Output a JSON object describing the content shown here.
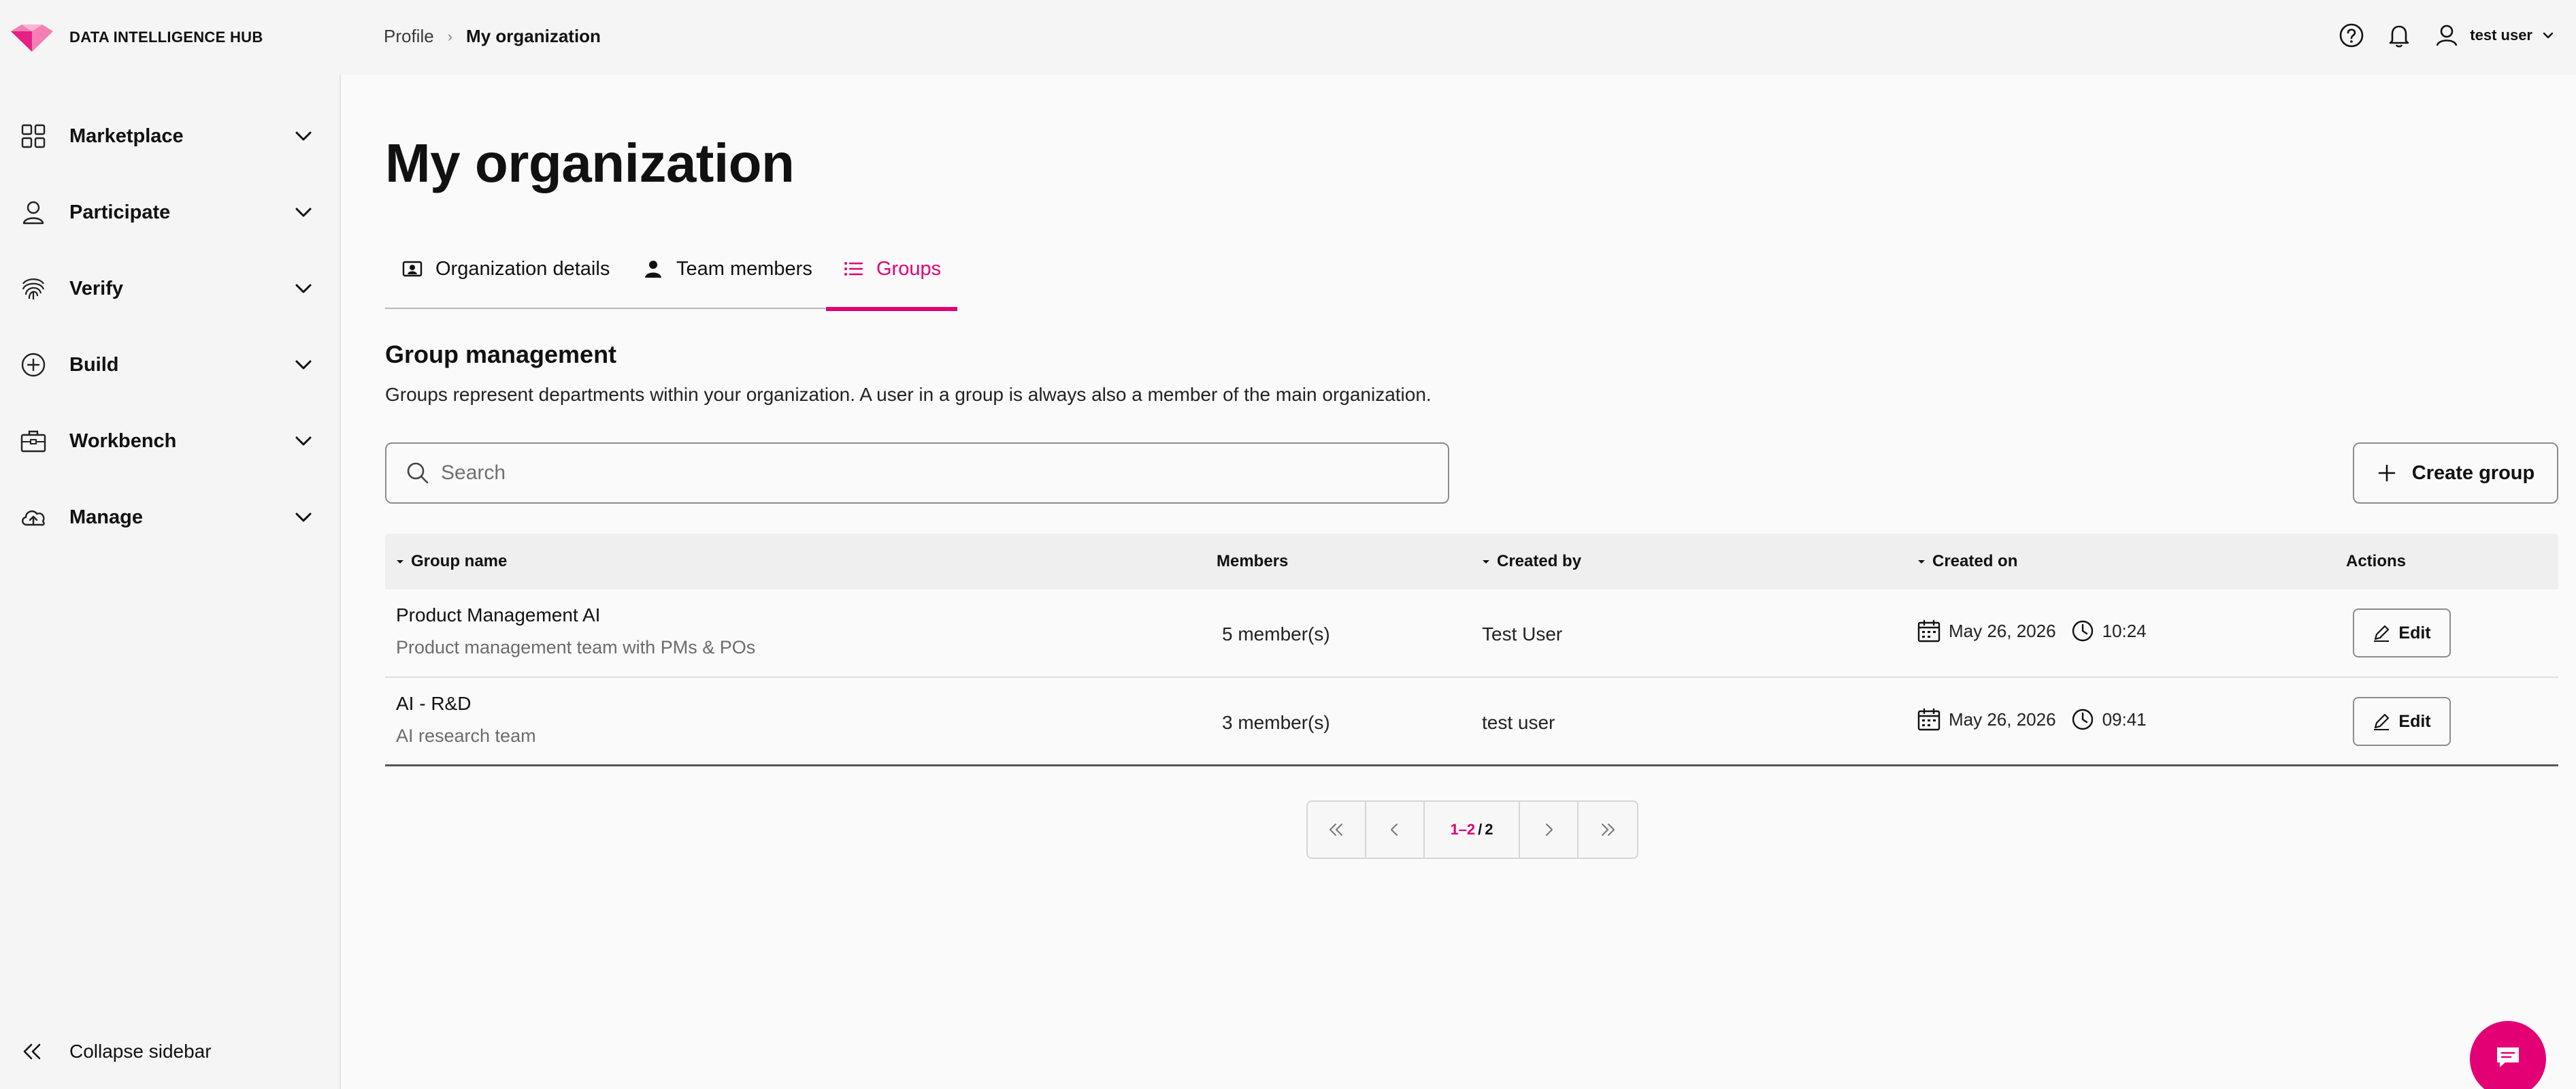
{
  "app": {
    "brand_name": "DATA INTELLIGENCE HUB",
    "accent_color": "#e20074"
  },
  "breadcrumb": {
    "items": [
      "Profile",
      "My organization"
    ]
  },
  "header": {
    "user_name": "test user",
    "icons": [
      "help-icon",
      "bell-icon",
      "user-icon",
      "chevron-down-icon"
    ]
  },
  "sidebar": {
    "items": [
      {
        "label": "Marketplace",
        "icon": "grid-icon"
      },
      {
        "label": "Participate",
        "icon": "person-icon"
      },
      {
        "label": "Verify",
        "icon": "fingerprint-icon"
      },
      {
        "label": "Build",
        "icon": "plus-circle-icon"
      },
      {
        "label": "Workbench",
        "icon": "toolbox-icon"
      },
      {
        "label": "Manage",
        "icon": "cloud-upload-icon"
      }
    ],
    "collapse_label": "Collapse sidebar"
  },
  "page": {
    "title": "My organization"
  },
  "tabs": [
    {
      "label": "Organization details",
      "icon": "id-card-icon",
      "active": false
    },
    {
      "label": "Team members",
      "icon": "person-icon",
      "active": false
    },
    {
      "label": "Groups",
      "icon": "list-icon",
      "active": true
    }
  ],
  "section": {
    "title": "Group management",
    "description": "Groups represent departments within your organization. A user in a group is always also a member of the main organization."
  },
  "search": {
    "placeholder": "Search",
    "value": ""
  },
  "create_button": {
    "label": "Create group"
  },
  "table": {
    "columns": [
      "Group name",
      "Members",
      "Created by",
      "Created on",
      "Actions"
    ],
    "rows": [
      {
        "name": "Product Management AI",
        "description": "Product management team with PMs & POs",
        "members": "5 member(s)",
        "created_by": "Test User",
        "date": "May 26, 2026",
        "time": "10:24",
        "action": "Edit"
      },
      {
        "name": "AI - R&D",
        "description": "AI research team",
        "members": "3 member(s)",
        "created_by": "test user",
        "date": "May 26, 2026",
        "time": "09:41",
        "action": "Edit"
      }
    ]
  },
  "pagination": {
    "range": "1–2",
    "separator": "/",
    "total": "2"
  }
}
